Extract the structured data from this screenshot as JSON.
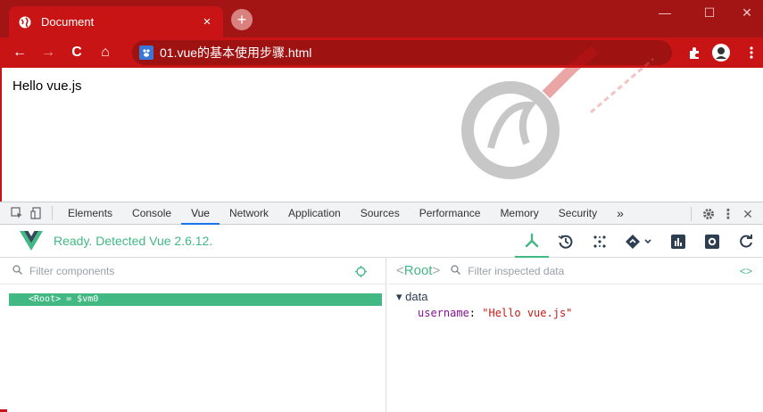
{
  "browser": {
    "tab_title": "Document",
    "tab_close": "×",
    "new_tab": "+",
    "window_controls": {
      "minimize": "—",
      "maximize": "☐",
      "close": "✕"
    },
    "nav": {
      "back": "←",
      "forward": "→",
      "reload": "C",
      "home": "⌂"
    },
    "address": "01.vue的基本使用步骤.html"
  },
  "page": {
    "text": "Hello vue.js"
  },
  "devtools": {
    "tabs": [
      "Elements",
      "Console",
      "Vue",
      "Network",
      "Application",
      "Sources",
      "Performance",
      "Memory",
      "Security"
    ],
    "active_tab": "Vue",
    "overflow": "»",
    "menu": "⋮",
    "close": "✕"
  },
  "vue": {
    "status": "Ready. Detected Vue 2.6.12.",
    "brand_color": "#42b883",
    "components": {
      "filter_placeholder": "Filter components",
      "root_row": "<Root> = $vm0"
    },
    "inspector": {
      "root_label": "Root",
      "root_open": "<",
      "root_close": ">",
      "filter_placeholder": "Filter inspected data",
      "code_icon": "<>",
      "section_arrow": "▾",
      "section": "data",
      "prop_key": "username",
      "prop_sep": ": ",
      "prop_value": "\"Hello vue.js\""
    }
  }
}
